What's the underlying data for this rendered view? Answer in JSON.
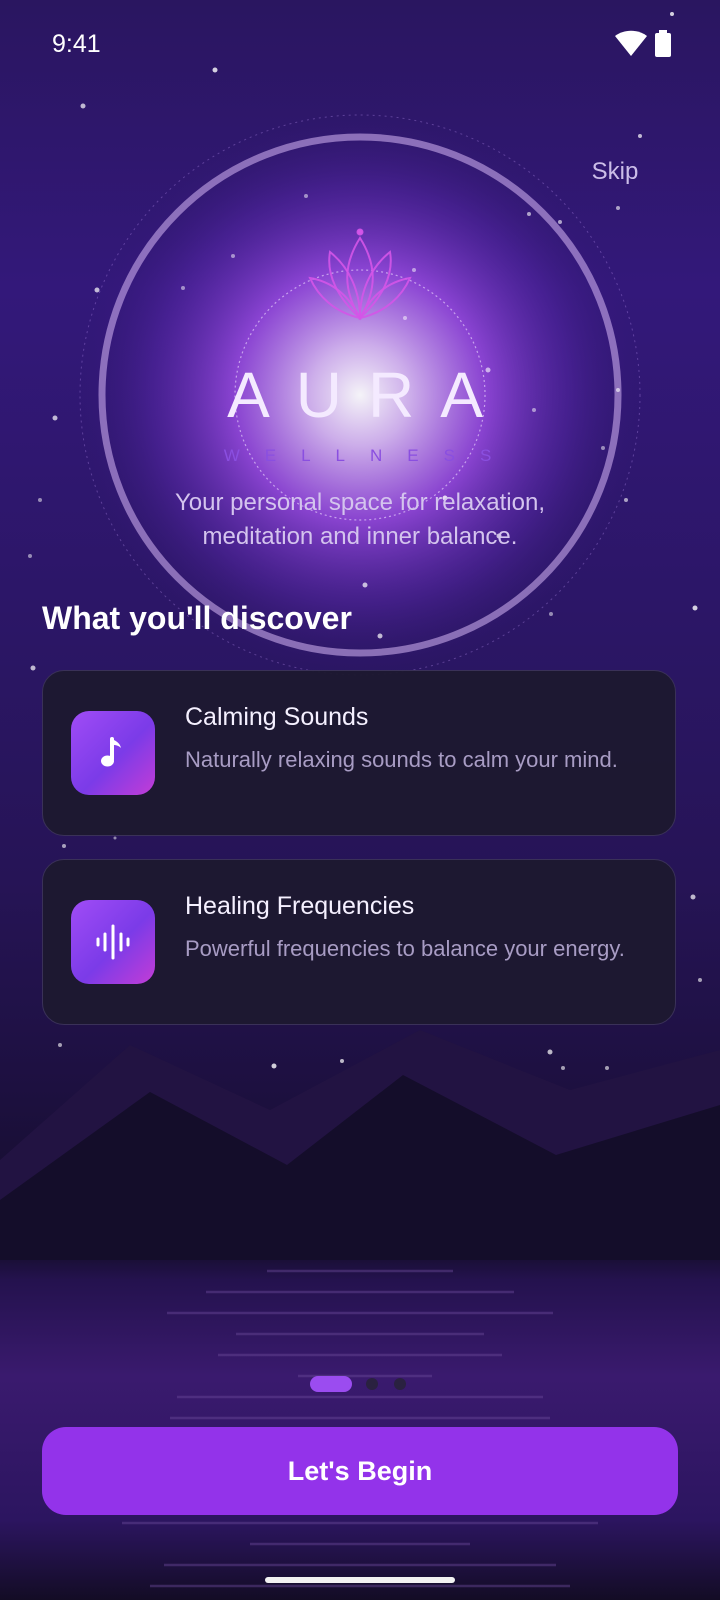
{
  "status_bar": {
    "time": "9:41",
    "wifi_icon": "wifi-icon",
    "battery_icon": "battery-icon"
  },
  "header": {
    "skip_label": "Skip"
  },
  "hero": {
    "logo_icon": "lotus-icon",
    "title": "AURA",
    "subtitle": "WELLNESS",
    "tagline_line1": "Your personal space for relaxation,",
    "tagline_line2": "meditation and inner balance."
  },
  "discover": {
    "heading": "What you'll discover",
    "cards": [
      {
        "icon": "music-note-icon",
        "title": "Calming Sounds",
        "description": "Naturally relaxing sounds to calm your mind."
      },
      {
        "icon": "sound-wave-icon",
        "title": "Healing Frequencies",
        "description": "Powerful frequencies to balance your energy."
      }
    ]
  },
  "pager": {
    "total_pages": 3,
    "current_page": 1
  },
  "cta": {
    "label": "Let's Begin"
  },
  "colors": {
    "accent": "#9333ea",
    "background_top": "#2a1660",
    "card_background": "#1d1930",
    "glow": "#b46cf8"
  }
}
